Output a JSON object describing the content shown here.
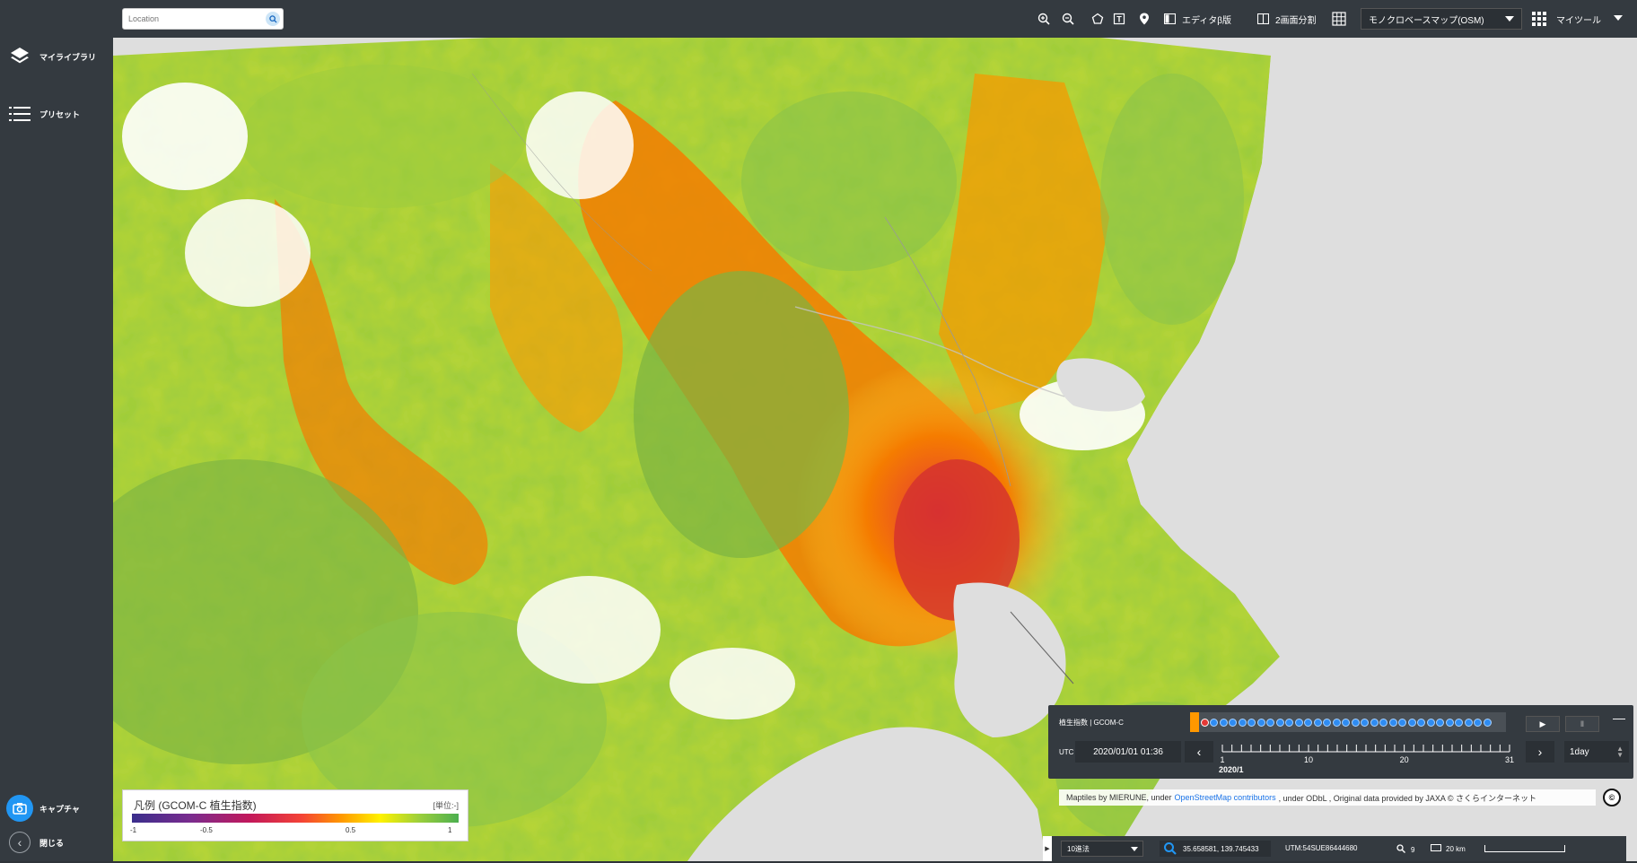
{
  "sidebar": {
    "my_library": "マイライブラリ",
    "preset": "プリセット",
    "capture": "キャプチャ",
    "close": "閉じる"
  },
  "search": {
    "placeholder": "Location"
  },
  "toolbar": {
    "editor_label": "エディタβ版",
    "split_label": "2画面分割",
    "basemap": "モノクロベースマップ(OSM)",
    "mytool": "マイツール"
  },
  "legend": {
    "title": "凡例 (GCOM-C 植生指数)",
    "unit": "[単位:-]",
    "ticks": [
      "-1",
      "-0.5",
      "0.5",
      "1"
    ]
  },
  "attribution": {
    "prefix": "Maptiles by MIERUNE, under",
    "link": "OpenStreetMap contributors",
    "suffix": ", under ODbL , Original data provided by JAXA © さくらインターネット"
  },
  "time_panel": {
    "layer": "植生指数 | GCOM-C",
    "utc_label": "UTC",
    "datetime": "2020/01/01 01:36",
    "interval": "1day",
    "scale_labels": [
      "1",
      "10",
      "20",
      "31"
    ],
    "month_label": "2020/1",
    "day_count": 31,
    "active_day": 1
  },
  "status": {
    "projection": "10進法",
    "coords": "35.658581, 139.745433",
    "utm": "UTM:54SUE86444680",
    "zoom": "9",
    "distance": "20 km"
  },
  "colors": {
    "accent": "#2196f3",
    "panel": "#343a40",
    "vegetation_low": "#e53935",
    "vegetation_mid": "#fdd835",
    "vegetation_high": "#7cb342"
  }
}
